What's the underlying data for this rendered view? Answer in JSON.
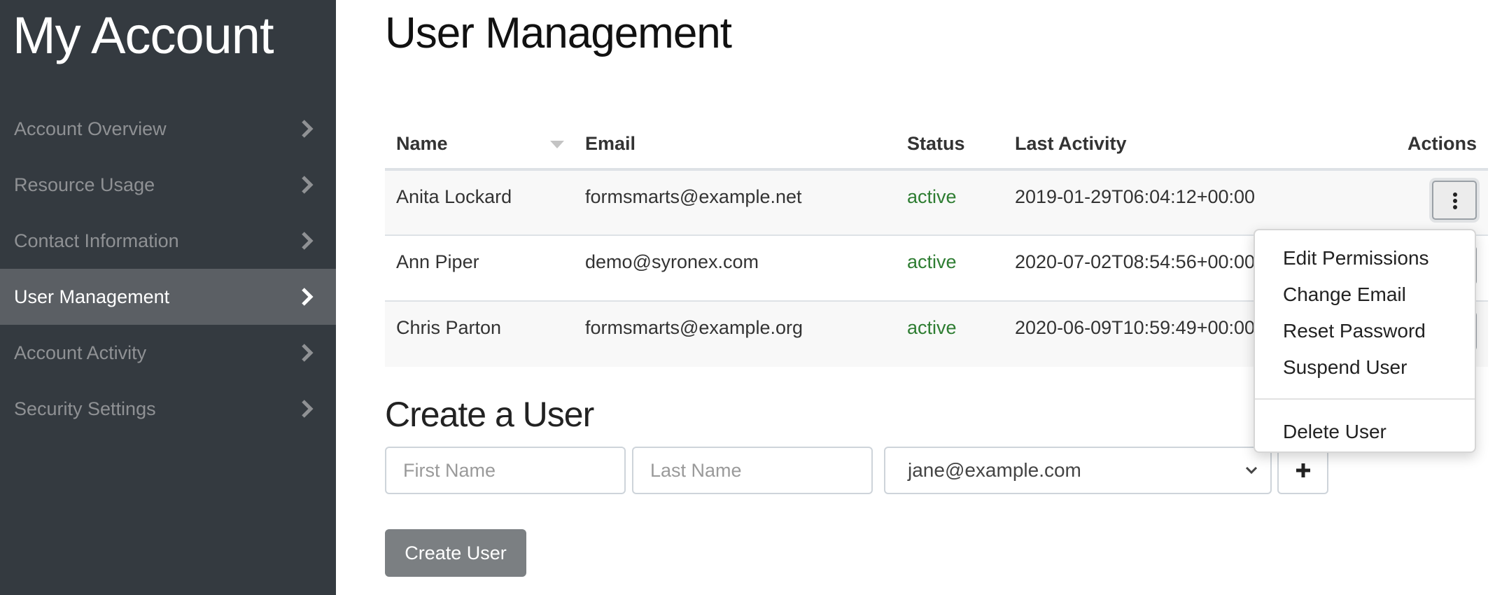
{
  "sidebar": {
    "title": "My Account",
    "items": [
      {
        "label": "Account Overview",
        "active": false
      },
      {
        "label": "Resource Usage",
        "active": false
      },
      {
        "label": "Contact Information",
        "active": false
      },
      {
        "label": "User Management",
        "active": true
      },
      {
        "label": "Account Activity",
        "active": false
      },
      {
        "label": "Security Settings",
        "active": false
      }
    ]
  },
  "main": {
    "title": "User Management",
    "table": {
      "columns": [
        "Name",
        "Email",
        "Status",
        "Last Activity",
        "Actions"
      ],
      "sorted_column": "Name",
      "rows": [
        {
          "name": "Anita Lockard",
          "email": "formsmarts@example.net",
          "status": "active",
          "last_activity": "2019-01-29T06:04:12+00:00"
        },
        {
          "name": "Ann Piper",
          "email": "demo@syronex.com",
          "status": "active",
          "last_activity": "2020-07-02T08:54:56+00:00"
        },
        {
          "name": "Chris Parton",
          "email": "formsmarts@example.org",
          "status": "active",
          "last_activity": "2020-06-09T10:59:49+00:00"
        }
      ]
    },
    "actions_menu": {
      "items": [
        "Edit Permissions",
        "Change Email",
        "Reset Password",
        "Suspend User"
      ],
      "danger_item": "Delete User"
    },
    "create_user": {
      "title": "Create a User",
      "first_name_placeholder": "First Name",
      "last_name_placeholder": "Last Name",
      "email_selected": "jane@example.com",
      "add_button_icon": "plus-icon",
      "submit_label": "Create User"
    }
  },
  "colors": {
    "sidebar_bg": "#343a40",
    "sidebar_active_bg": "#5b5f64",
    "status_active": "#2e7d32",
    "primary_button": "#7b7f82"
  }
}
